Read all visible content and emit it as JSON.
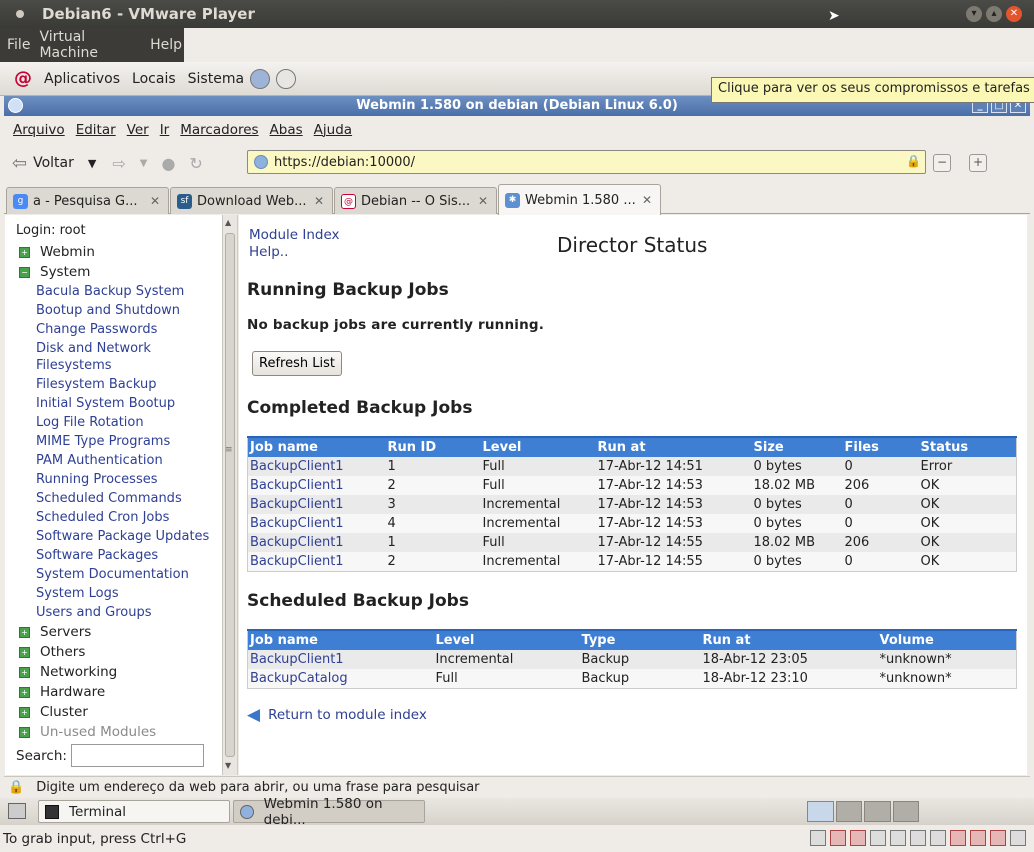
{
  "vmware": {
    "title": "Debian6 - VMware Player",
    "menu": [
      "File",
      "Virtual Machine",
      "Help"
    ],
    "status_hint": "To grab input, press Ctrl+G"
  },
  "gnome_panel": {
    "menu": [
      "Aplicativos",
      "Locais",
      "Sistema"
    ],
    "tooltip": "Clique para ver os seus compromissos e tarefas"
  },
  "firefox": {
    "title": "Webmin 1.580 on debian (Debian Linux 6.0)",
    "menu": [
      "Arquivo",
      "Editar",
      "Ver",
      "Ir",
      "Marcadores",
      "Abas",
      "Ajuda"
    ],
    "back_label": "Voltar",
    "url": "https://debian:10000/",
    "tabs": [
      {
        "label": "a - Pesquisa G...",
        "icon": "google-icon"
      },
      {
        "label": "Download Web...",
        "icon": "sourceforge-icon"
      },
      {
        "label": "Debian -- O Sis...",
        "icon": "debian-icon"
      },
      {
        "label": "Webmin 1.580 ...",
        "icon": "webmin-icon"
      }
    ],
    "status_text": "Digite um endereço da web para abrir, ou uma frase para pesquisar"
  },
  "sidebar": {
    "login": "Login: root",
    "categories_top": [
      "Webmin",
      "System"
    ],
    "system_modules": [
      "Bacula Backup System",
      "Bootup and Shutdown",
      "Change Passwords",
      "Disk and Network",
      "Filesystems",
      "Filesystem Backup",
      "Initial System Bootup",
      "Log File Rotation",
      "MIME Type Programs",
      "PAM Authentication",
      "Running Processes",
      "Scheduled Commands",
      "Scheduled Cron Jobs",
      "Software Package Updates",
      "Software Packages",
      "System Documentation",
      "System Logs",
      "Users and Groups"
    ],
    "categories_bottom": [
      "Servers",
      "Others",
      "Networking",
      "Hardware",
      "Cluster",
      "Un-used Modules"
    ],
    "search_label": "Search:"
  },
  "main": {
    "module_index": "Module Index",
    "help": "Help..",
    "title": "Director Status",
    "running_heading": "Running Backup Jobs",
    "no_jobs": "No backup jobs are currently running.",
    "refresh_label": "Refresh List",
    "completed_heading": "Completed Backup Jobs",
    "completed_columns": [
      "Job name",
      "Run ID",
      "Level",
      "Run at",
      "Size",
      "Files",
      "Status"
    ],
    "completed_rows": [
      [
        "BackupClient1",
        "1",
        "Full",
        "17-Abr-12 14:51",
        "0 bytes",
        "0",
        "Error"
      ],
      [
        "BackupClient1",
        "2",
        "Full",
        "17-Abr-12 14:53",
        "18.02 MB",
        "206",
        "OK"
      ],
      [
        "BackupClient1",
        "3",
        "Incremental",
        "17-Abr-12 14:53",
        "0 bytes",
        "0",
        "OK"
      ],
      [
        "BackupClient1",
        "4",
        "Incremental",
        "17-Abr-12 14:53",
        "0 bytes",
        "0",
        "OK"
      ],
      [
        "BackupClient1",
        "1",
        "Full",
        "17-Abr-12 14:55",
        "18.02 MB",
        "206",
        "OK"
      ],
      [
        "BackupClient1",
        "2",
        "Incremental",
        "17-Abr-12 14:55",
        "0 bytes",
        "0",
        "OK"
      ]
    ],
    "scheduled_heading": "Scheduled Backup Jobs",
    "scheduled_columns": [
      "Job name",
      "Level",
      "Type",
      "Run at",
      "Volume"
    ],
    "scheduled_rows": [
      [
        "BackupClient1",
        "Incremental",
        "Backup",
        "18-Abr-12 23:05",
        "*unknown*"
      ],
      [
        "BackupCatalog",
        "Full",
        "Backup",
        "18-Abr-12 23:10",
        "*unknown*"
      ]
    ],
    "return_label": "Return to module index"
  },
  "taskbar": {
    "items": [
      "Terminal",
      "Webmin 1.580 on debi..."
    ]
  },
  "colors": {
    "table_header": "#3f7fd3",
    "link": "#2e3f94",
    "url_bar": "#fbf8c4",
    "tooltip": "#fbf8b5"
  }
}
